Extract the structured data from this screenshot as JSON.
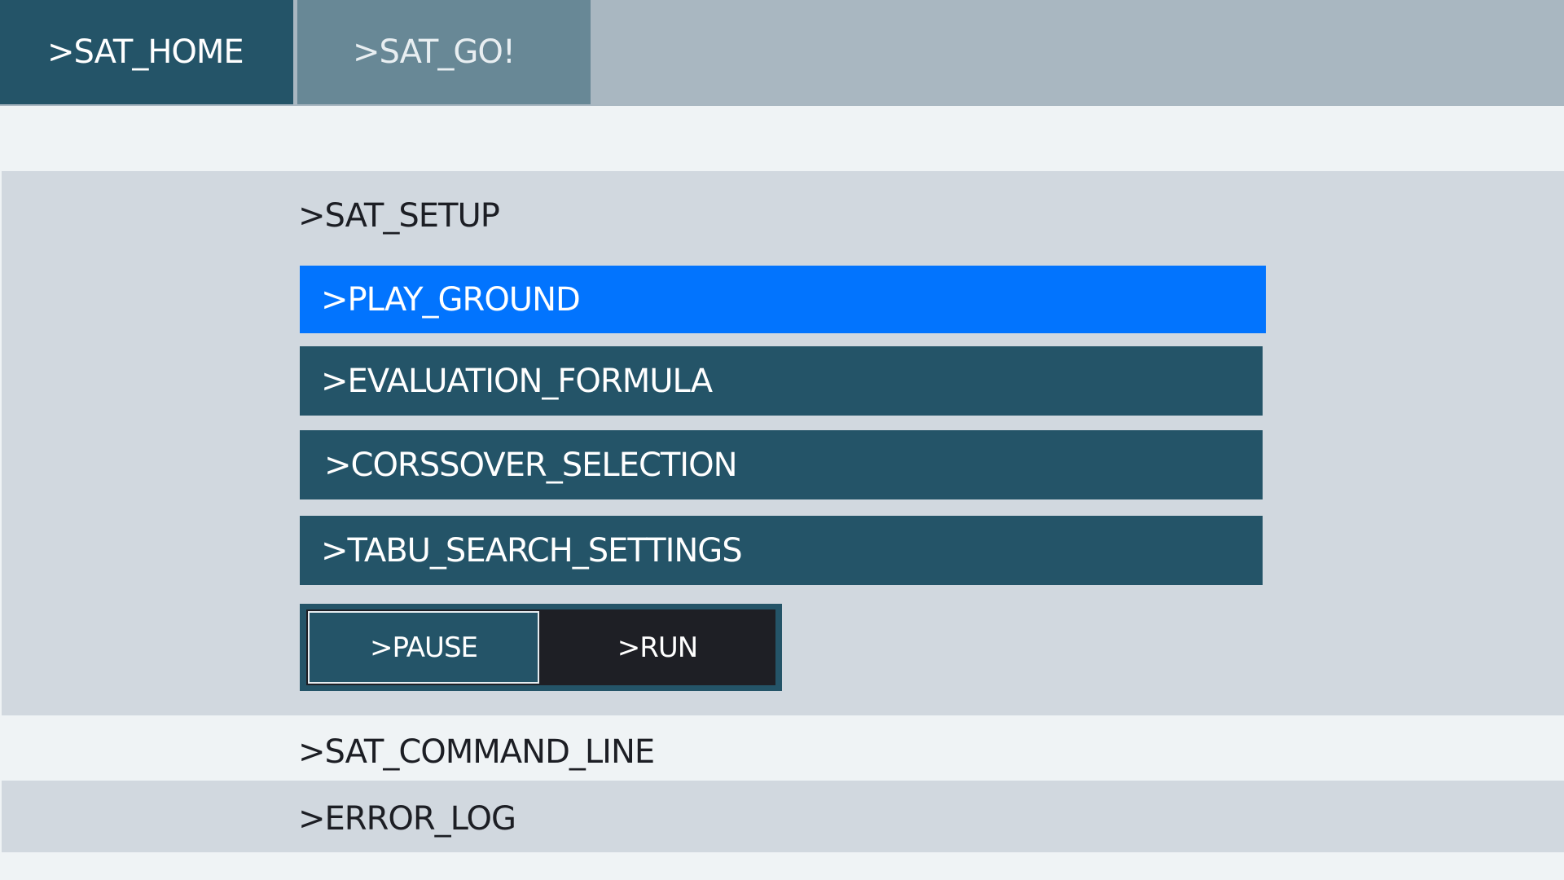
{
  "tabs": {
    "home_label": ">SAT_HOME",
    "go_label": ">SAT_GO!"
  },
  "setup": {
    "title": ">SAT_SETUP",
    "items": [
      {
        "label": ">PLAY_GROUND",
        "active": true
      },
      {
        "label": ">EVALUATION_FORMULA",
        "active": false
      },
      {
        "label": ">CORSSOVER_SELECTION",
        "active": false
      },
      {
        "label": ">TABU_SEARCH_SETTINGS",
        "active": false
      }
    ],
    "controls": {
      "pause_label": ">PAUSE",
      "run_label": ">RUN"
    }
  },
  "command_line": {
    "title": ">SAT_COMMAND_LINE"
  },
  "error_log": {
    "title": ">ERROR_LOG"
  },
  "colors": {
    "accent_active": "#0274fe",
    "primary_dark": "#245468",
    "tab_inactive": "#688896",
    "tabbar_bg": "#a9b7c1",
    "section_bg": "#d1d8df",
    "page_bg": "#eff3f5",
    "run_bg": "#1e1f25"
  }
}
